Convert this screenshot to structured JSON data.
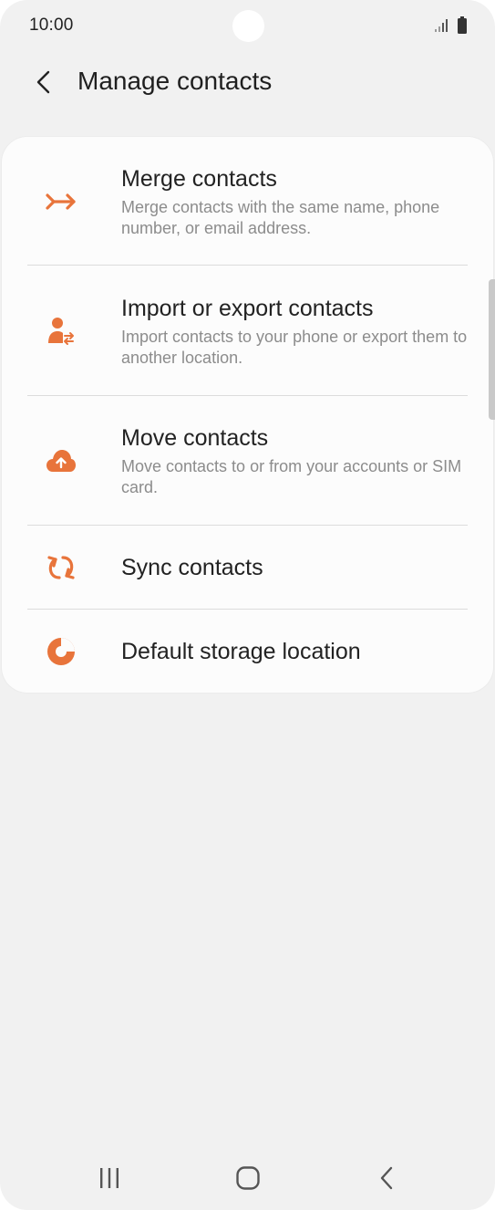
{
  "status_bar": {
    "time": "10:00",
    "signal_icon": "signal-icon",
    "battery_icon": "battery-icon"
  },
  "header": {
    "back_icon": "chevron-left-icon",
    "title": "Manage contacts"
  },
  "colors": {
    "accent": "#e8743b",
    "background": "#f1f1f1",
    "card": "#fcfcfc",
    "title_text": "#222222",
    "secondary_text": "#8c8c8c"
  },
  "menu": {
    "items": [
      {
        "icon": "merge-icon",
        "title": "Merge contacts",
        "description": "Merge contacts with the same name, phone number, or email address."
      },
      {
        "icon": "import-export-person-icon",
        "title": "Import or export contacts",
        "description": "Import contacts to your phone or export them to another location."
      },
      {
        "icon": "cloud-upload-icon",
        "title": "Move contacts",
        "description": "Move contacts to or from your accounts or SIM card."
      },
      {
        "icon": "sync-icon",
        "title": "Sync contacts"
      },
      {
        "icon": "storage-pie-icon",
        "title": "Default storage location"
      }
    ]
  },
  "nav_bar": {
    "recents_icon": "recents-icon",
    "home_icon": "home-icon",
    "back_icon": "back-nav-icon"
  }
}
